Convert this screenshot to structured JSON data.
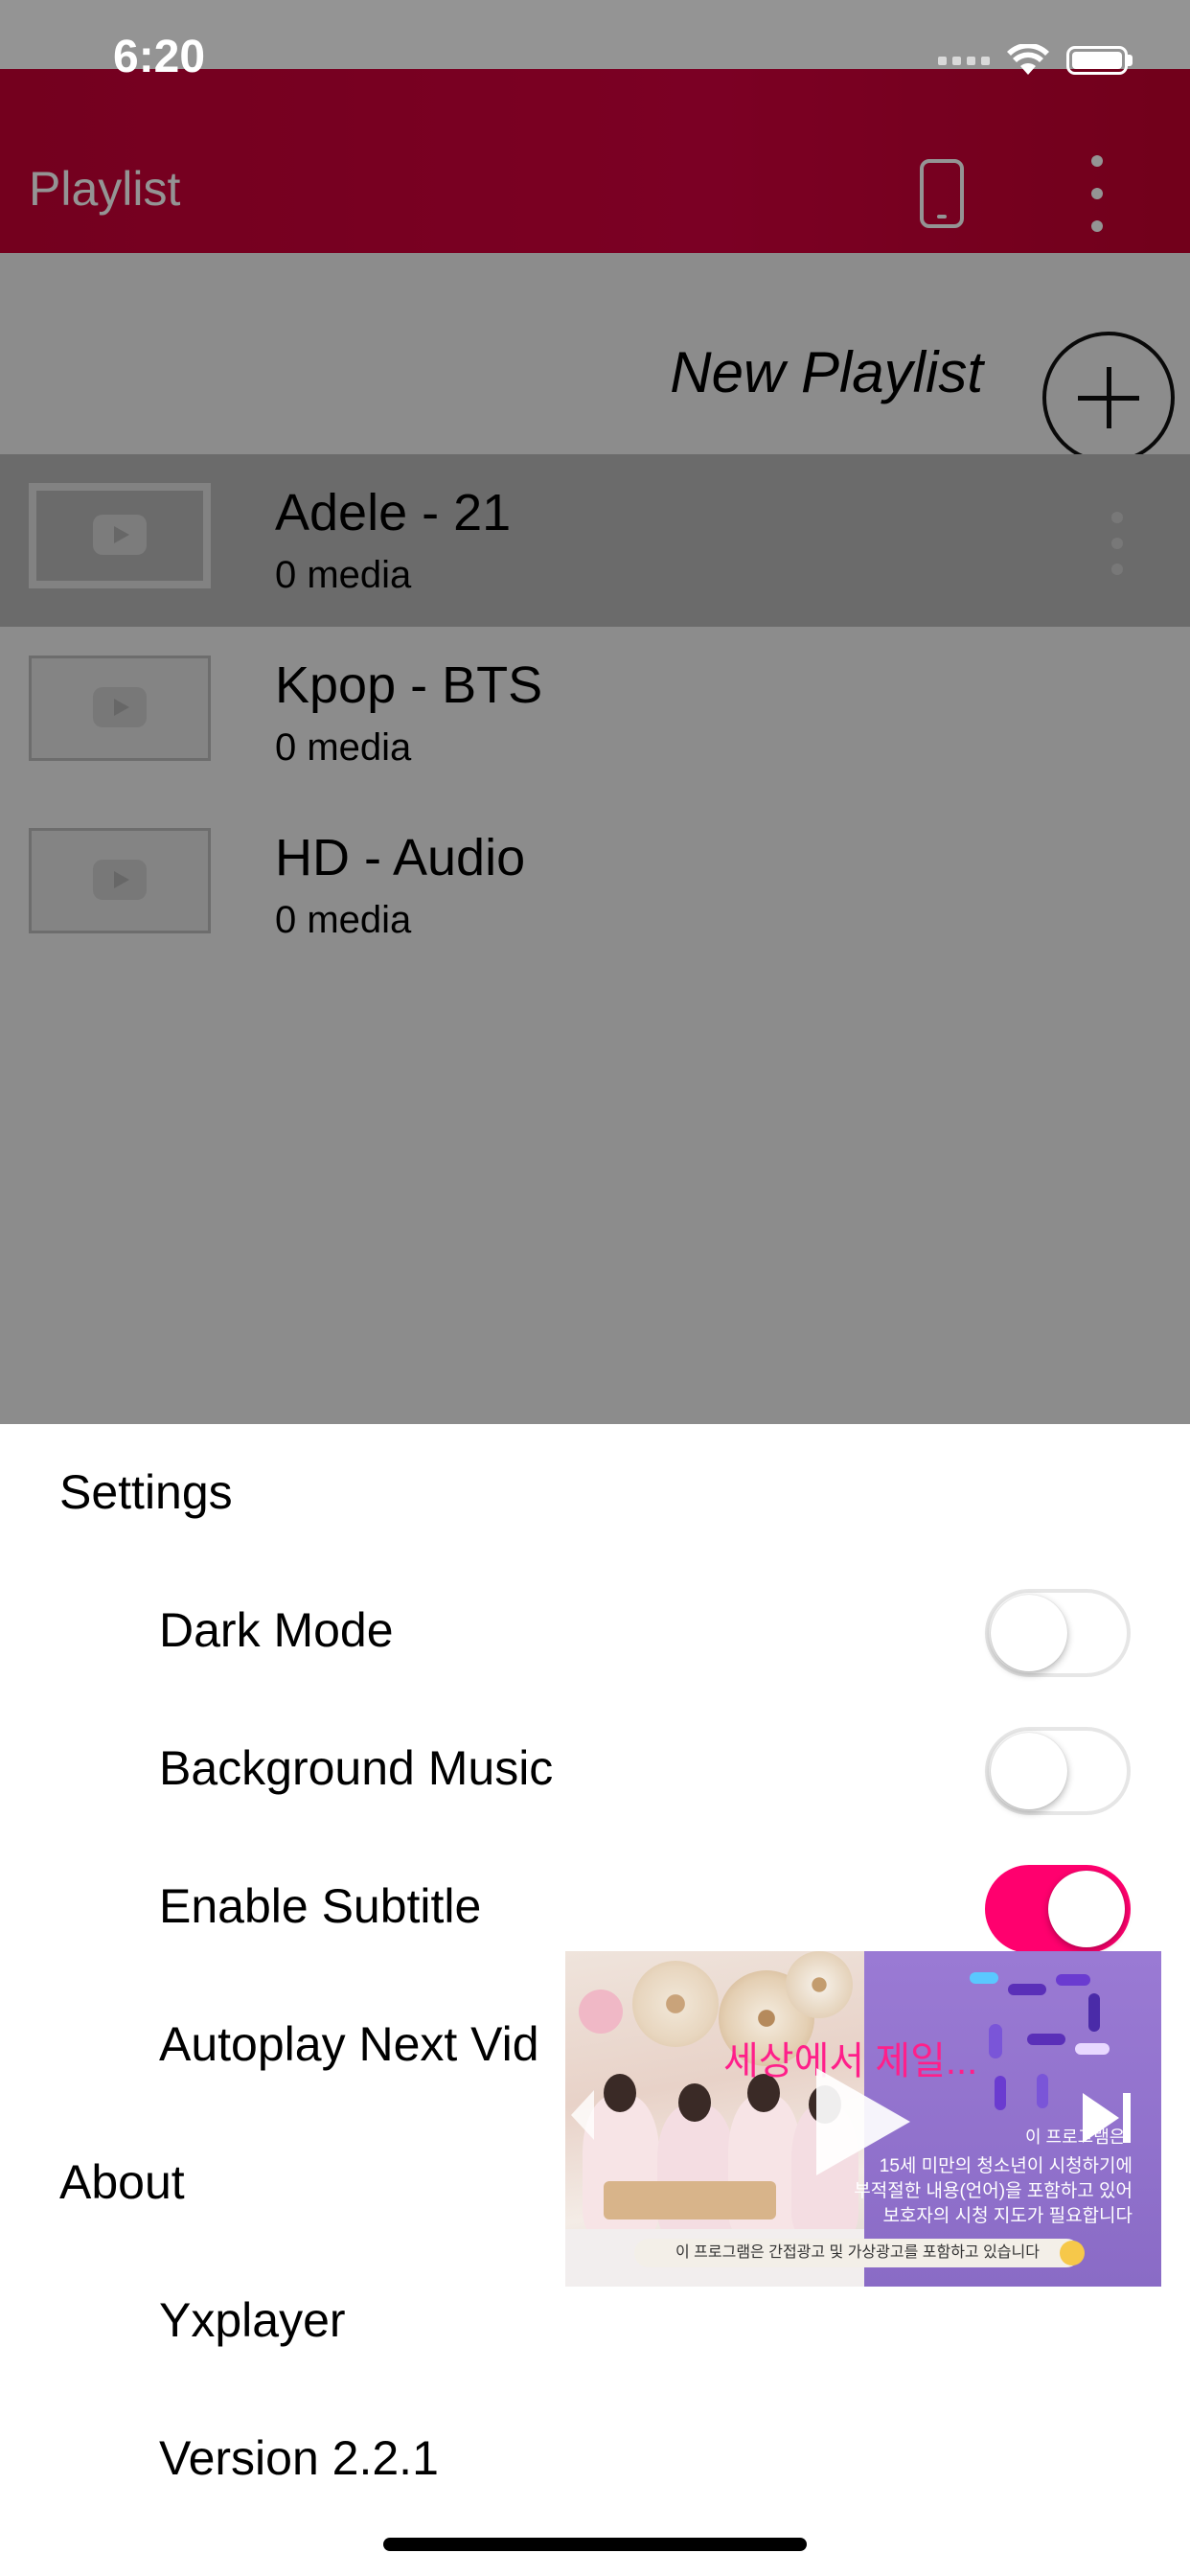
{
  "status_bar": {
    "time": "6:20"
  },
  "nav": {
    "title": "Playlist"
  },
  "new_playlist": {
    "label": "New Playlist"
  },
  "playlists": [
    {
      "name": "Adele - 21",
      "count": "0 media",
      "selected": true
    },
    {
      "name": "Kpop - BTS",
      "count": "0 media",
      "selected": false
    },
    {
      "name": "HD - Audio",
      "count": "0 media",
      "selected": false
    }
  ],
  "settings": {
    "section_title": "Settings",
    "dark_mode": {
      "label": "Dark Mode",
      "on": false
    },
    "background_music": {
      "label": "Background Music",
      "on": false
    },
    "enable_subtitle": {
      "label": "Enable Subtitle",
      "on": true
    },
    "autoplay": {
      "label": "Autoplay Next Vid"
    }
  },
  "about": {
    "section_title": "About",
    "app_name": "Yxplayer",
    "version": "Version 2.2.1"
  },
  "mini_player": {
    "banner_text": "세상에서 제일...",
    "rating_title": "이 프로그램은",
    "rating_text": "15세 미만의 청소년이 시청하기에\n부적절한 내용(언어)을 포함하고 있어\n보호자의 시청 지도가 필요합니다",
    "notice": "이 프로그램은 간접광고 및 가상광고를 포함하고 있습니다"
  },
  "colors": {
    "accent": "#d5003e",
    "toggle_on": "#ff006e"
  }
}
